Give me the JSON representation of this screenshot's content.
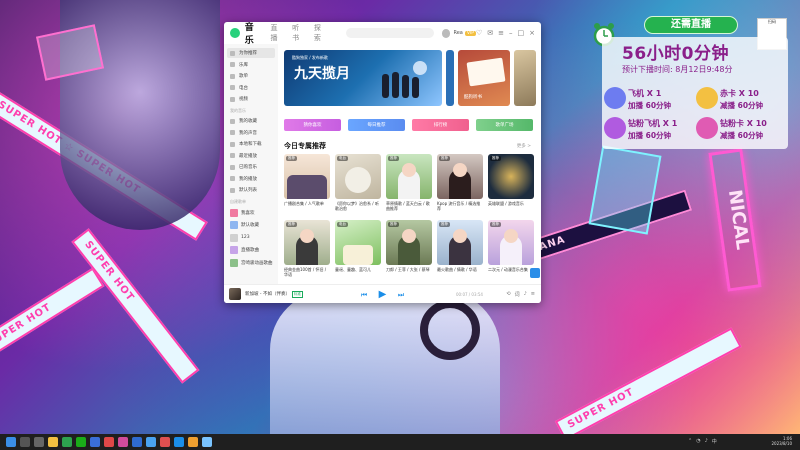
{
  "music_app": {
    "top_tabs": [
      "音乐",
      "直播",
      "听书",
      "探索"
    ],
    "user": {
      "name": "Rea",
      "vip": "VIP"
    },
    "sidebar": {
      "items": [
        "为你推荐",
        "乐库",
        "歌单",
        "电台",
        "视频"
      ],
      "my_music_label": "我的音乐",
      "my_items": [
        "我的收藏",
        "我的声音",
        "本地和下载",
        "最近播放",
        "已购音乐",
        "我的播放",
        "默认列表"
      ],
      "playlists_label": "自建歌单",
      "playlists": [
        "我喜欢",
        "默认收藏",
        "123",
        "直播歌曲",
        "宫崎骏动画歌曲"
      ]
    },
    "banner": {
      "tag": "酷狗独家 / 发布新歌",
      "title": "九天揽月",
      "subtitle": "SINGER"
    },
    "side_banner": {
      "label": "酷狗听书"
    },
    "quick_buttons": [
      "猜你喜欢",
      "每日推荐",
      "排行榜",
      "歌单广场"
    ],
    "section_title": "今日专属推荐",
    "section_more": "更多 >",
    "cards_row1": [
      {
        "badge": "推荐",
        "caption": "广播剧合集 / 人气歌单"
      },
      {
        "badge": "电台",
        "caption": "《愿你以梦》治愈系 / 听歌治愈"
      },
      {
        "badge": "推荐",
        "caption": "草原情歌 / 蓝天白云 / 歌曲推荐"
      },
      {
        "badge": "推荐",
        "caption": "Kpop 流行音乐 / 精选推荐"
      },
      {
        "badge": "推荐",
        "caption": "英雄联盟 / 游戏音乐"
      }
    ],
    "cards_row2": [
      {
        "badge": "推荐",
        "caption": "经典金曲100首 / 怀旧 / 华语"
      },
      {
        "badge": "电台",
        "caption": "童谣、童趣、蓝可儿"
      },
      {
        "badge": "推荐",
        "caption": "刀郎 / 王菲 / 大张 / 蔡琴"
      },
      {
        "badge": "推荐",
        "caption": "最火歌曲 / 情歌 / 华语"
      },
      {
        "badge": "推荐",
        "caption": "二次元 / 动漫音乐合集"
      }
    ],
    "player": {
      "song": "新加坡 - 不如（伴奏）",
      "tag": "标准",
      "time": "00:07 / 03:54"
    }
  },
  "live_overlay": {
    "title": "还需直播",
    "countdown": "56小时0分钟",
    "expected_end": "预计下播时间: 8月12日9:48分",
    "gifts": [
      {
        "name": "飞机 X 1",
        "action": "加播 60分钟",
        "color": "#6d7cf0"
      },
      {
        "name": "赤卡 X 10",
        "action": "减播 60分钟",
        "color": "#f3c041"
      },
      {
        "name": "钻粉飞机 X 1",
        "action": "加播 60分钟",
        "color": "#b05be0"
      },
      {
        "name": "钻粉卡 X 10",
        "action": "减播 60分钟",
        "color": "#e05bb3"
      }
    ],
    "qr_label": "扫码"
  },
  "wallpaper": {
    "band_text": "SUPER HOT",
    "neon_text": "NICAL",
    "sign_text": "NAGIRA NANA"
  },
  "taskbar": {
    "time": "1:06",
    "date": "2023/8/10"
  }
}
